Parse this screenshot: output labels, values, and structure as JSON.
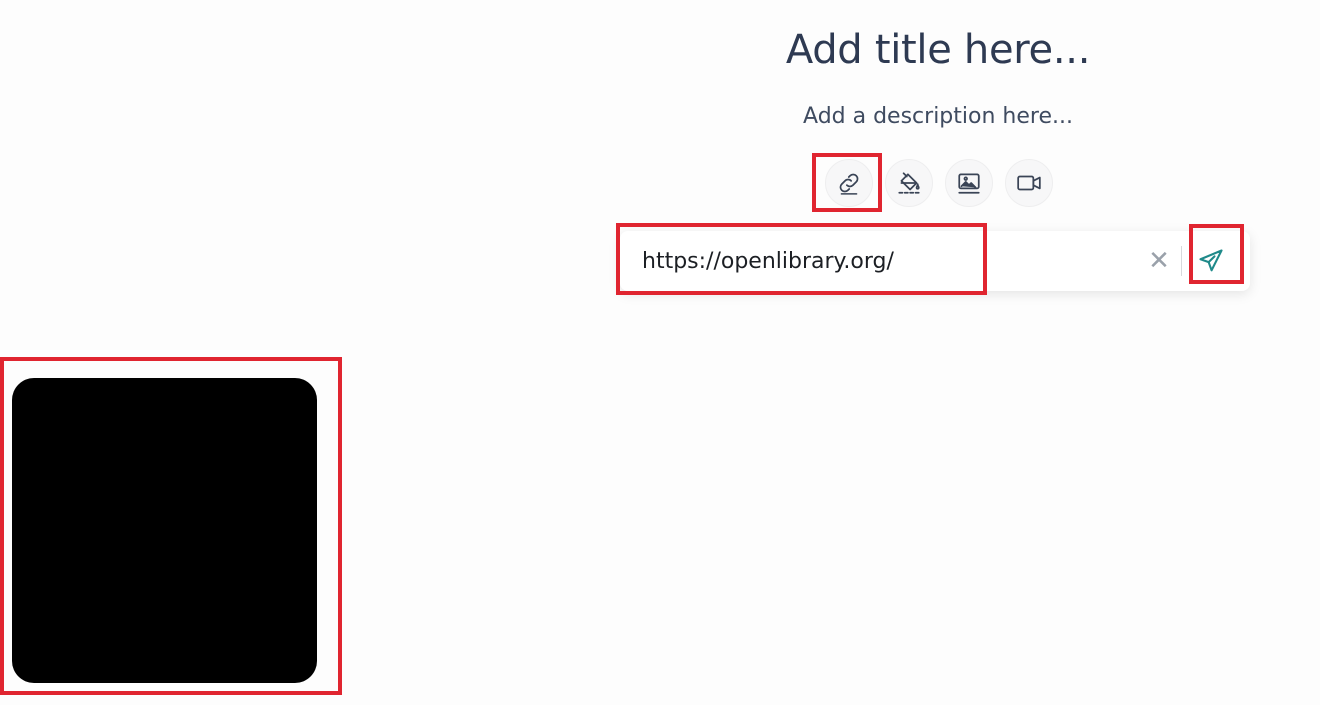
{
  "header": {
    "title": "Add title here...",
    "description": "Add a description here..."
  },
  "toolbar": {
    "buttons": [
      {
        "name": "link",
        "icon": "link-icon"
      },
      {
        "name": "fill",
        "icon": "paint-bucket-icon"
      },
      {
        "name": "image",
        "icon": "image-icon"
      },
      {
        "name": "video",
        "icon": "video-camera-icon"
      }
    ]
  },
  "link_panel": {
    "url_value": "https://openlibrary.org/",
    "clear_symbol": "✕",
    "send_icon": "paper-plane-icon"
  },
  "colors": {
    "highlight": "#e02530",
    "accent": "#1f8a8a",
    "text": "#2e3a52",
    "card": "#000000"
  }
}
